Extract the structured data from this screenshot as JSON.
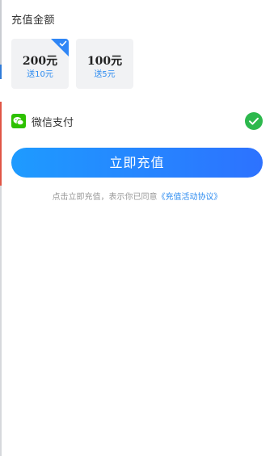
{
  "section_title": "充值金额",
  "amount_options": [
    {
      "value": "200元",
      "gift": "送10元",
      "selected": true
    },
    {
      "value": "100元",
      "gift": "送5元",
      "selected": false
    }
  ],
  "payment": {
    "icon": "wechat-icon",
    "label": "微信支付",
    "selected": true
  },
  "recharge_button": "立即充值",
  "agreement": {
    "prefix": "点击立即充值，表示你已同意",
    "link": "《充值活动协议》"
  },
  "colors": {
    "accent": "#2e8cf0",
    "button_start": "#1e9bff",
    "button_end": "#2d72ff",
    "wechat_green": "#2dc100",
    "check_green": "#2db84d"
  }
}
